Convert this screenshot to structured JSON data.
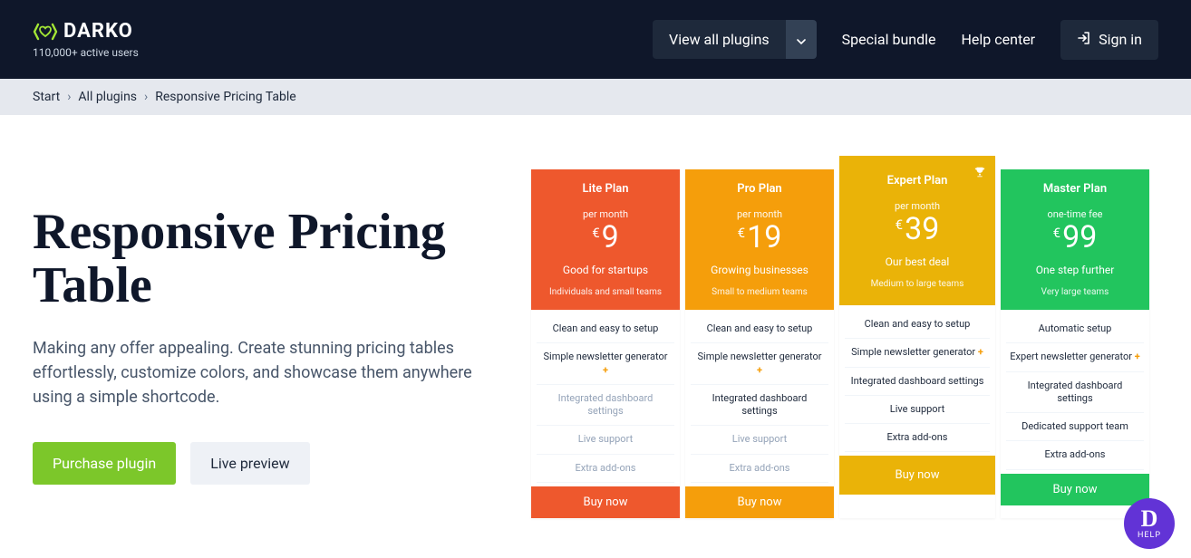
{
  "header": {
    "brand": "DARKO",
    "subtitle": "110,000+ active users",
    "view_plugins": "View all plugins",
    "special_bundle": "Special bundle",
    "help_center": "Help center",
    "sign_in": "Sign in"
  },
  "breadcrumb": {
    "start": "Start",
    "all_plugins": "All plugins",
    "current": "Responsive Pricing Table"
  },
  "hero": {
    "title": "Responsive Pricing Table",
    "desc": "Making any offer appealing. Create stunning pricing tables effortlessly, customize colors, and showcase them anywhere using a simple shortcode.",
    "purchase": "Purchase plugin",
    "preview": "Live preview"
  },
  "plans": [
    {
      "name": "Lite Plan",
      "period": "per month",
      "currency": "€",
      "price": "9",
      "tagline": "Good for startups",
      "audience": "Individuals and small teams",
      "header_color": "#ee582d",
      "buy_color": "#ee582d",
      "buy": "Buy now",
      "features": [
        {
          "text": "Clean and easy to setup",
          "muted": false,
          "plus": false
        },
        {
          "text": "Simple newsletter generator",
          "muted": false,
          "plus": true
        },
        {
          "text": "Integrated dashboard settings",
          "muted": true,
          "plus": false
        },
        {
          "text": "Live support",
          "muted": true,
          "plus": false
        },
        {
          "text": "Extra add-ons",
          "muted": true,
          "plus": false
        }
      ],
      "featured": false
    },
    {
      "name": "Pro Plan",
      "period": "per month",
      "currency": "€",
      "price": "19",
      "tagline": "Growing businesses",
      "audience": "Small to medium teams",
      "header_color": "#f59e0b",
      "buy_color": "#f59e0b",
      "buy": "Buy now",
      "features": [
        {
          "text": "Clean and easy to setup",
          "muted": false,
          "plus": false
        },
        {
          "text": "Simple newsletter generator",
          "muted": false,
          "plus": true
        },
        {
          "text": "Integrated dashboard settings",
          "muted": false,
          "plus": false
        },
        {
          "text": "Live support",
          "muted": true,
          "plus": false
        },
        {
          "text": "Extra add-ons",
          "muted": true,
          "plus": false
        }
      ],
      "featured": false
    },
    {
      "name": "Expert Plan",
      "period": "per month",
      "currency": "€",
      "price": "39",
      "tagline": "Our best deal",
      "audience": "Medium to large teams",
      "header_color": "#eab308",
      "buy_color": "#eab308",
      "buy": "Buy now",
      "features": [
        {
          "text": "Clean and easy to setup",
          "muted": false,
          "plus": false
        },
        {
          "text": "Simple newsletter generator",
          "muted": false,
          "plus": true
        },
        {
          "text": "Integrated dashboard settings",
          "muted": false,
          "plus": false
        },
        {
          "text": "Live support",
          "muted": false,
          "plus": false
        },
        {
          "text": "Extra add-ons",
          "muted": false,
          "plus": false
        }
      ],
      "featured": true
    },
    {
      "name": "Master Plan",
      "period": "one-time fee",
      "currency": "€",
      "price": "99",
      "tagline": "One step further",
      "audience": "Very large teams",
      "header_color": "#22c55e",
      "buy_color": "#22c55e",
      "buy": "Buy now",
      "features": [
        {
          "text": "Automatic setup",
          "muted": false,
          "plus": false
        },
        {
          "text": "Expert newsletter generator",
          "muted": false,
          "plus": true
        },
        {
          "text": "Integrated dashboard settings",
          "muted": false,
          "plus": false
        },
        {
          "text": "Dedicated support team",
          "muted": false,
          "plus": false
        },
        {
          "text": "Extra add-ons",
          "muted": false,
          "plus": false
        }
      ],
      "featured": false
    }
  ],
  "help_widget": {
    "letter": "D",
    "label": "HELP"
  }
}
